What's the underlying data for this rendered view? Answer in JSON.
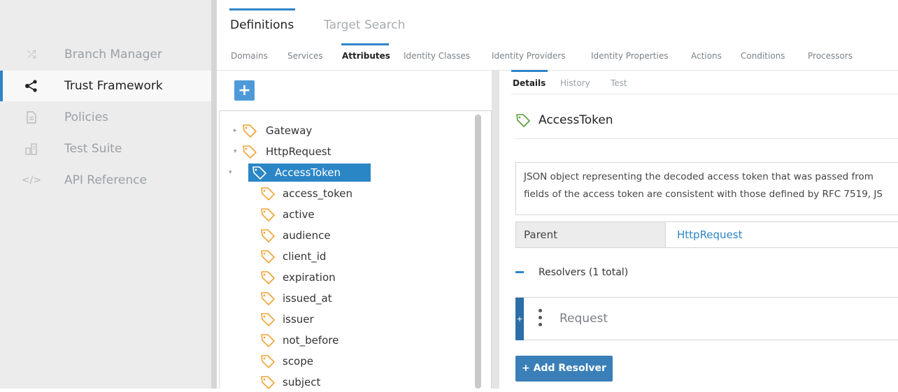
{
  "sidebar": {
    "items": [
      {
        "label": "Branch Manager",
        "icon": "shuffle-icon"
      },
      {
        "label": "Trust Framework",
        "icon": "share-nodes-icon"
      },
      {
        "label": "Policies",
        "icon": "document-icon"
      },
      {
        "label": "Test Suite",
        "icon": "test-suite-icon"
      },
      {
        "label": "API Reference",
        "icon": "code-icon"
      }
    ],
    "active_index": 1
  },
  "top_tabs": [
    "Definitions",
    "Target Search"
  ],
  "sub_tabs": [
    "Domains",
    "Services",
    "Attributes",
    "Identity Classes",
    "Identity Providers",
    "Identity Properties",
    "Actions",
    "Conditions",
    "Processors"
  ],
  "tree": {
    "add_label": "+",
    "nodes": [
      {
        "label": "Gateway",
        "expander": "▸"
      },
      {
        "label": "HttpRequest",
        "expander": "▾"
      },
      {
        "label": "AccessToken",
        "expander": "▾"
      },
      {
        "label": "access_token"
      },
      {
        "label": "active"
      },
      {
        "label": "audience"
      },
      {
        "label": "client_id"
      },
      {
        "label": "expiration"
      },
      {
        "label": "issued_at"
      },
      {
        "label": "issuer"
      },
      {
        "label": "not_before"
      },
      {
        "label": "scope"
      },
      {
        "label": "subject"
      }
    ],
    "selected": "AccessToken"
  },
  "detail": {
    "tabs": [
      "Details",
      "History",
      "Test"
    ],
    "title": "AccessToken",
    "description_line1": "JSON object representing the decoded access token that was passed from",
    "description_line2": "fields of the access token are consistent with those defined by RFC 7519, JS",
    "parent_label": "Parent",
    "parent_value": "HttpRequest",
    "resolvers_label": "Resolvers (1 total)",
    "resolver_handle": "+",
    "resolver_name": "Request",
    "add_resolver_label": "+ Add Resolver"
  },
  "colors": {
    "accent": "#2e85c7",
    "selected_row": "#2b86c5",
    "tag_icon": "#f0a43a",
    "title_tag_icon": "#5a9e3a"
  }
}
